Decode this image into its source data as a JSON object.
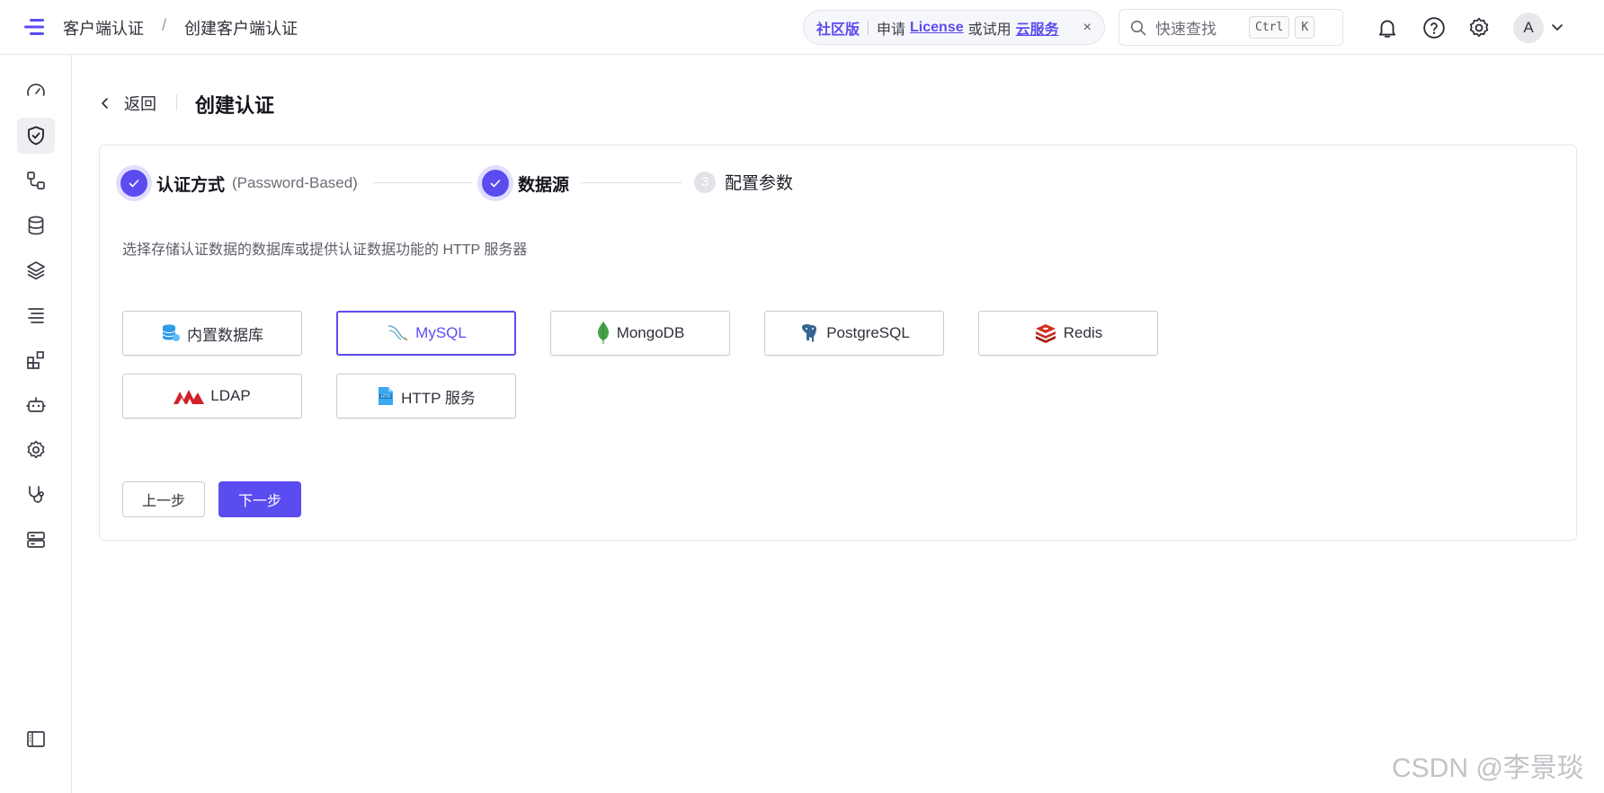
{
  "header": {
    "breadcrumb": [
      "客户端认证",
      "/",
      "创建客户端认证"
    ],
    "promo": {
      "edition": "社区版",
      "text_apply": "申请",
      "license_link": "License",
      "text_or": "或试用",
      "cloud_link": "云服务",
      "close": "×"
    },
    "search": {
      "placeholder": "快速查找",
      "kbd1": "Ctrl",
      "kbd2": "K"
    },
    "avatar_letter": "A"
  },
  "page": {
    "back_label": "返回",
    "title": "创建认证"
  },
  "steps": [
    {
      "label": "认证方式",
      "sub": "(Password-Based)",
      "status": "done"
    },
    {
      "label": "数据源",
      "sub": "",
      "status": "done"
    },
    {
      "number": "3",
      "label": "配置参数",
      "status": "pending"
    }
  ],
  "description": "选择存储认证数据的数据库或提供认证数据功能的 HTTP 服务器",
  "datasources": [
    {
      "label": "内置数据库",
      "icon": "builtin-db-icon",
      "selected": false
    },
    {
      "label": "MySQL",
      "icon": "mysql-icon",
      "selected": true
    },
    {
      "label": "MongoDB",
      "icon": "mongodb-icon",
      "selected": false
    },
    {
      "label": "PostgreSQL",
      "icon": "postgresql-icon",
      "selected": false
    },
    {
      "label": "Redis",
      "icon": "redis-icon",
      "selected": false
    },
    {
      "label": "LDAP",
      "icon": "ldap-icon",
      "selected": false
    },
    {
      "label": "HTTP 服务",
      "icon": "http-icon",
      "selected": false
    }
  ],
  "buttons": {
    "prev": "上一步",
    "next": "下一步"
  },
  "watermark": "CSDN @李景琰",
  "colors": {
    "accent": "#5b4cf0"
  }
}
